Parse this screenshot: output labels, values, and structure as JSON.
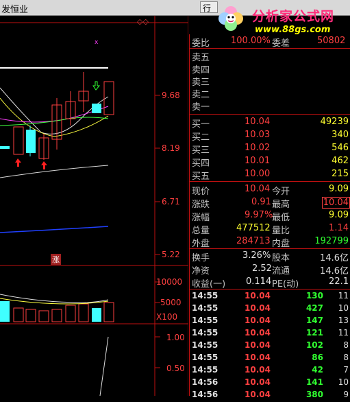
{
  "window": {
    "title": "发恒业",
    "button_label": "行"
  },
  "logo": {
    "name": "分析家公式网",
    "url": "www.88gs.com"
  },
  "chart": {
    "price_ticks": [
      "9.68",
      "8.19",
      "6.71",
      "5.22"
    ],
    "volume_ticks": [
      "10000",
      "5000"
    ],
    "volume_multiplier": "X100",
    "indicator_ticks": [
      "1.00",
      "0.50"
    ],
    "limit_up_marker": "涨"
  },
  "quote": {
    "weibi_label": "委比",
    "weibi_value": "100.00%",
    "weicha_label": "委差",
    "weicha_value": "50802",
    "sells": [
      {
        "label": "卖五"
      },
      {
        "label": "卖四"
      },
      {
        "label": "卖三"
      },
      {
        "label": "卖二"
      },
      {
        "label": "卖一"
      }
    ],
    "buys": [
      {
        "label": "买一",
        "price": "10.04",
        "vol": "49239"
      },
      {
        "label": "买二",
        "price": "10.03",
        "vol": "340"
      },
      {
        "label": "买三",
        "price": "10.02",
        "vol": "546"
      },
      {
        "label": "买四",
        "price": "10.01",
        "vol": "462"
      },
      {
        "label": "买五",
        "price": "10.00",
        "vol": "215"
      }
    ],
    "stats": [
      {
        "l1": "现价",
        "v1": "10.04",
        "l2": "今开",
        "v2": "9.09"
      },
      {
        "l1": "涨跌",
        "v1": "0.91",
        "l2": "最高",
        "v2": "10.04"
      },
      {
        "l1": "涨幅",
        "v1": "9.97%",
        "l2": "最低",
        "v2": "9.09"
      },
      {
        "l1": "总量",
        "v1": "477512",
        "l2": "量比",
        "v2": "1.14"
      },
      {
        "l1": "外盘",
        "v1": "284713",
        "l2": "内盘",
        "v2": "192799"
      }
    ],
    "fund": [
      {
        "l1": "换手",
        "v1": "3.26%",
        "l2": "股本",
        "v2": "14.6亿"
      },
      {
        "l1": "净资",
        "v1": "2.52",
        "l2": "流通",
        "v2": "14.6亿"
      },
      {
        "l1": "收益(一)",
        "v1": "0.114",
        "l2": "PE(动)",
        "v2": "22.1"
      }
    ],
    "trades": [
      {
        "time": "14:55",
        "price": "10.04",
        "vol": "130",
        "n": "11"
      },
      {
        "time": "14:55",
        "price": "10.04",
        "vol": "427",
        "n": "10"
      },
      {
        "time": "14:55",
        "price": "10.04",
        "vol": "147",
        "n": "13"
      },
      {
        "time": "14:55",
        "price": "10.04",
        "vol": "121",
        "n": "11"
      },
      {
        "time": "14:55",
        "price": "10.04",
        "vol": "102",
        "n": "8"
      },
      {
        "time": "14:55",
        "price": "10.04",
        "vol": "86",
        "n": "8"
      },
      {
        "time": "14:55",
        "price": "10.04",
        "vol": "42",
        "n": "7"
      },
      {
        "time": "14:56",
        "price": "10.04",
        "vol": "141",
        "n": "10"
      },
      {
        "time": "14:56",
        "price": "10.04",
        "vol": "380",
        "n": "9"
      }
    ]
  },
  "colors": {
    "up": "#ff4040",
    "down": "#30ff30",
    "border": "#c01010",
    "cyan": "#40ffff"
  }
}
